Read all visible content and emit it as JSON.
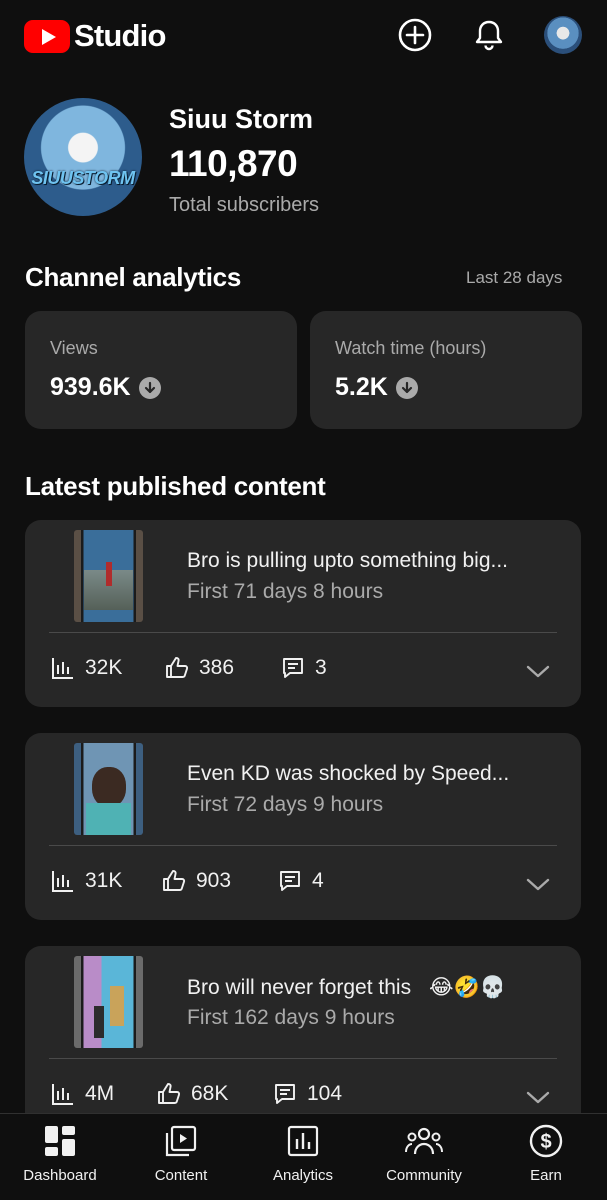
{
  "header": {
    "logo_text": "Studio",
    "brand_color": "#ff0000"
  },
  "channel": {
    "name": "Siuu Storm",
    "subscribers": "110,870",
    "subscribers_label": "Total subscribers",
    "avatar_text": "SIUUSTORM"
  },
  "analytics": {
    "title": "Channel analytics",
    "range": "Last 28 days",
    "metrics": [
      {
        "label": "Views",
        "value": "939.6K",
        "trend_icon": "down-arrow-icon"
      },
      {
        "label": "Watch time (hours)",
        "value": "5.2K",
        "trend_icon": "down-arrow-icon"
      }
    ]
  },
  "latest": {
    "title": "Latest published content",
    "items": [
      {
        "title": "Bro is pulling upto something big...",
        "subtitle": "First 71 days 8 hours",
        "views": "32K",
        "likes": "386",
        "comments": "3"
      },
      {
        "title": "Even KD was shocked by Speed...",
        "subtitle": "First 72 days 9 hours",
        "views": "31K",
        "likes": "903",
        "comments": "4"
      },
      {
        "title": "Bro will never forget this",
        "title_emoji": "😂🤣💀",
        "subtitle": "First 162 days 9 hours",
        "views": "4M",
        "likes": "68K",
        "comments": "104"
      }
    ]
  },
  "nav": {
    "items": [
      {
        "label": "Dashboard",
        "icon": "dashboard-icon"
      },
      {
        "label": "Content",
        "icon": "content-icon"
      },
      {
        "label": "Analytics",
        "icon": "analytics-icon"
      },
      {
        "label": "Community",
        "icon": "community-icon"
      },
      {
        "label": "Earn",
        "icon": "earn-icon"
      }
    ]
  }
}
